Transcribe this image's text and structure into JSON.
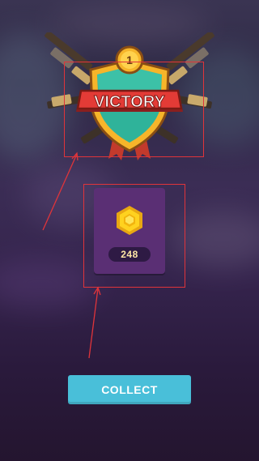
{
  "emblem": {
    "rank": "1",
    "banner_text": "VICTORY"
  },
  "reward": {
    "icon": "gold-coin-icon",
    "amount": "248"
  },
  "actions": {
    "collect_label": "COLLECT"
  },
  "colors": {
    "card": "#5a2f74",
    "button": "#49bfd9",
    "banner": "#e33b36",
    "shield_inner": "#2fb39a",
    "shield_border": "#f6b52a",
    "annotation": "#e0343a"
  }
}
